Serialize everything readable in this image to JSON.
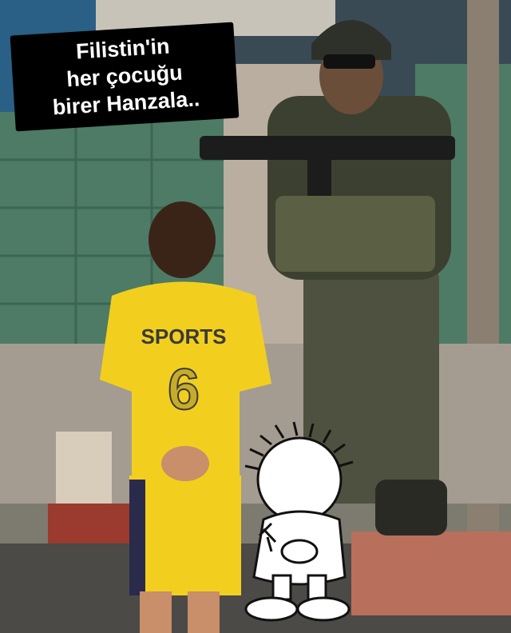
{
  "caption": {
    "line1": "Filistin'in",
    "line2": "her çocuğu",
    "line3": "birer Hanzala.."
  },
  "shop_sign_text": "",
  "jersey": {
    "text": "SPORTS",
    "number": "6"
  },
  "colors": {
    "jersey_yellow": "#f2cf1f",
    "uniform_olive": "#4e513f",
    "wall_green": "#4d7b66",
    "caption_bg": "#000000"
  }
}
